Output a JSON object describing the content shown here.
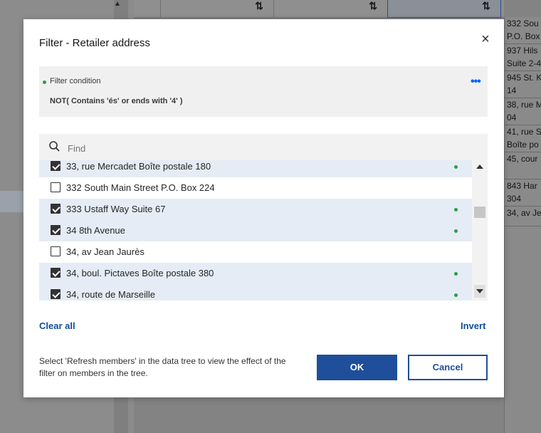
{
  "background": {
    "sort_icon": "⇅",
    "right_column_cells": [
      {
        "text": "332 Sou\nP.O. Box"
      },
      {
        "text": "937 Hils\nSuite 2-4"
      },
      {
        "text": "945 St. K\n14"
      },
      {
        "text": "38, rue M\n04"
      },
      {
        "text": "41, rue S\nBoîte po"
      },
      {
        "text": "45, cour"
      },
      {
        "text": "843 Har\n304"
      },
      {
        "text": "34, av Je"
      }
    ]
  },
  "dialog": {
    "title": "Filter - Retailer address",
    "close_icon": "×",
    "condition": {
      "label": "Filter condition",
      "text": "NOT( Contains 'és' or ends with '4' )",
      "more_icon": "•••"
    },
    "find": {
      "placeholder": "Find"
    },
    "items": [
      {
        "label": "33, rue Mercadet Boîte postale 180",
        "checked": true
      },
      {
        "label": "332 South Main Street P.O. Box 224",
        "checked": false
      },
      {
        "label": "333 Ustaff Way Suite 67",
        "checked": true
      },
      {
        "label": "34 8th Avenue",
        "checked": true
      },
      {
        "label": "34, av Jean Jaurès",
        "checked": false
      },
      {
        "label": "34, boul. Pictaves Boîte postale 380",
        "checked": true
      },
      {
        "label": "34, route de Marseille",
        "checked": true
      }
    ],
    "clear_all": "Clear all",
    "invert": "Invert",
    "note": "Select 'Refresh members' in the data tree to view the effect of the filter on members in the tree.",
    "ok": "OK",
    "cancel": "Cancel"
  },
  "colors": {
    "accent": "#1f4e9a",
    "selected_row": "#e5ecf5",
    "dot_green": "#24a148"
  }
}
